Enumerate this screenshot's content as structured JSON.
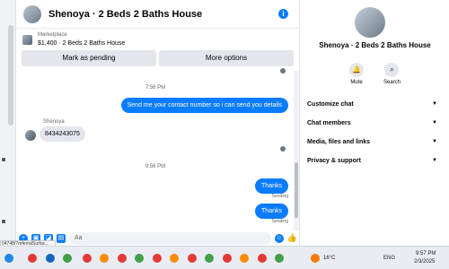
{
  "chat": {
    "title": "Shenoya · 2 Beds 2 Baths House",
    "marketplace_label": "Marketplace",
    "listing": "$1,400 · 2 Beds 2 Baths House",
    "mark_pending_label": "Mark as pending",
    "more_options_label": "More options",
    "composer_placeholder": "Aa"
  },
  "messages": [
    {
      "type": "timestamp",
      "text": "7:56 PM"
    },
    {
      "type": "outgoing",
      "text": "Send me your contact number so i can send you details"
    },
    {
      "type": "incoming",
      "sender": "Shenoya",
      "text": "8434243075"
    },
    {
      "type": "timestamp",
      "text": "9:56 PM"
    },
    {
      "type": "outgoing",
      "text": "Thanks",
      "status": "Sending"
    },
    {
      "type": "outgoing",
      "text": "Thanks",
      "status": "Sending"
    }
  ],
  "url_fragment": "04748/?referralSurfac...",
  "panel": {
    "title": "Shenoya · 2 Beds 2 Baths House",
    "mute_label": "Mute",
    "search_label": "Search",
    "sections": [
      "Customize chat",
      "Chat members",
      "Media, files and links",
      "Privacy & support"
    ]
  },
  "taskbar": {
    "temperature": "16°C",
    "language": "ENG",
    "time": "9:57 PM",
    "date": "2/3/2025"
  },
  "colors": {
    "accent": "#0a7cff",
    "bubble_in": "#e4e6eb",
    "muted_text": "#65676b"
  },
  "icons": [
    "info-icon",
    "bell-icon",
    "search-icon",
    "chevron-down-icon",
    "plus-icon",
    "image-icon",
    "sticker-icon",
    "gif-icon",
    "emoji-icon",
    "thumbs-up-icon"
  ]
}
